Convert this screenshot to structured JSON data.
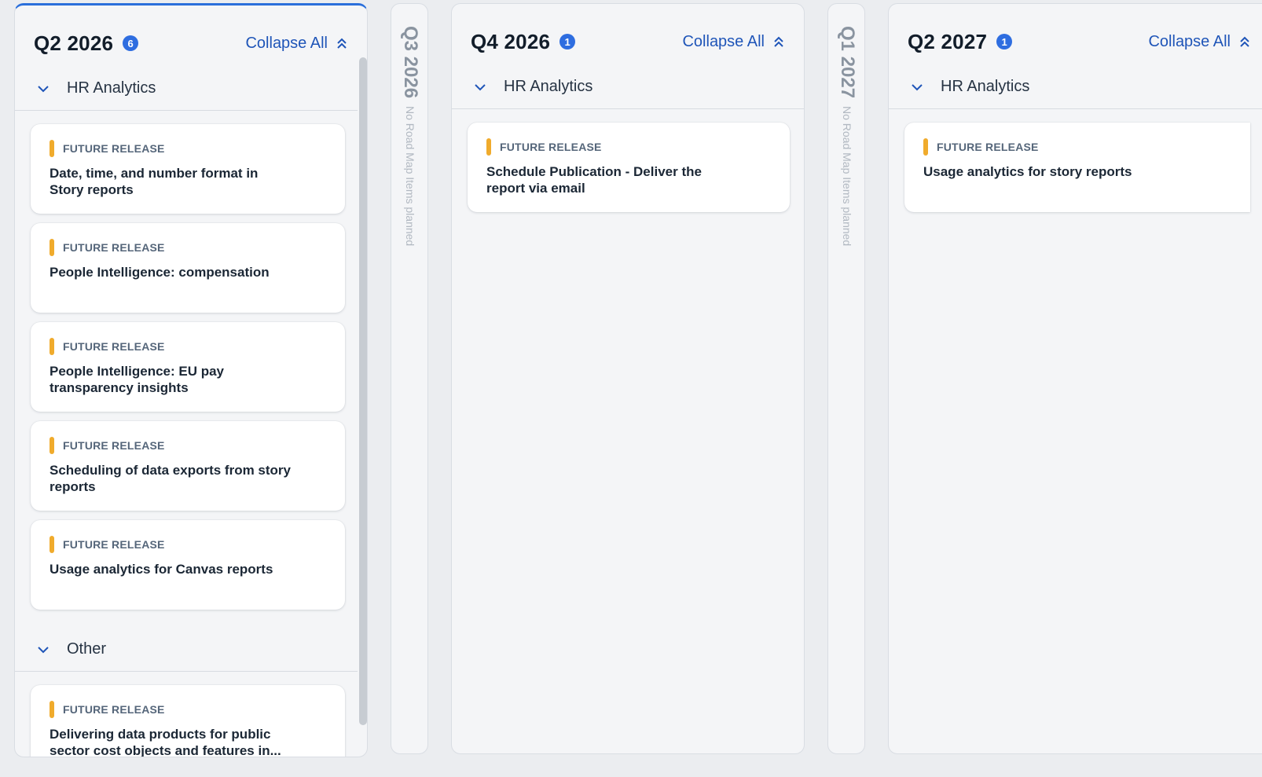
{
  "columns": [
    {
      "title": "Q2 2026",
      "count": "6",
      "collapse_label": "Collapse All",
      "groups": [
        {
          "label": "HR Analytics",
          "cards": [
            {
              "tag": "FUTURE RELEASE",
              "title": "Date, time, and number format in Story reports"
            },
            {
              "tag": "FUTURE RELEASE",
              "title": "People Intelligence: compensation"
            },
            {
              "tag": "FUTURE RELEASE",
              "title": "People Intelligence: EU pay transparency insights"
            },
            {
              "tag": "FUTURE RELEASE",
              "title": "Scheduling of data exports from story reports"
            },
            {
              "tag": "FUTURE RELEASE",
              "title": "Usage analytics for Canvas reports"
            }
          ]
        },
        {
          "label": "Other",
          "cards": [
            {
              "tag": "FUTURE RELEASE",
              "title": "Delivering data products for public sector cost objects and features in..."
            }
          ]
        }
      ]
    },
    {
      "title": "Q4 2026",
      "count": "1",
      "collapse_label": "Collapse All",
      "groups": [
        {
          "label": "HR Analytics",
          "cards": [
            {
              "tag": "FUTURE RELEASE",
              "title": "Schedule Publication - Deliver the report via email"
            }
          ]
        }
      ]
    },
    {
      "title": "Q2 2027",
      "count": "1",
      "collapse_label": "Collapse All",
      "groups": [
        {
          "label": "HR Analytics",
          "cards": [
            {
              "tag": "FUTURE RELEASE",
              "title": "Usage analytics for story reports"
            }
          ]
        }
      ]
    }
  ],
  "empty_quarters": [
    {
      "title": "Q3 2026",
      "note": "No Road Map Items planned"
    },
    {
      "title": "Q1 2027",
      "note": "No Road Map Items planned"
    }
  ],
  "colors": {
    "accent": "#2e6de0",
    "link": "#1f55b8",
    "status_future": "#f0ab2c",
    "background": "#ebedf0"
  }
}
